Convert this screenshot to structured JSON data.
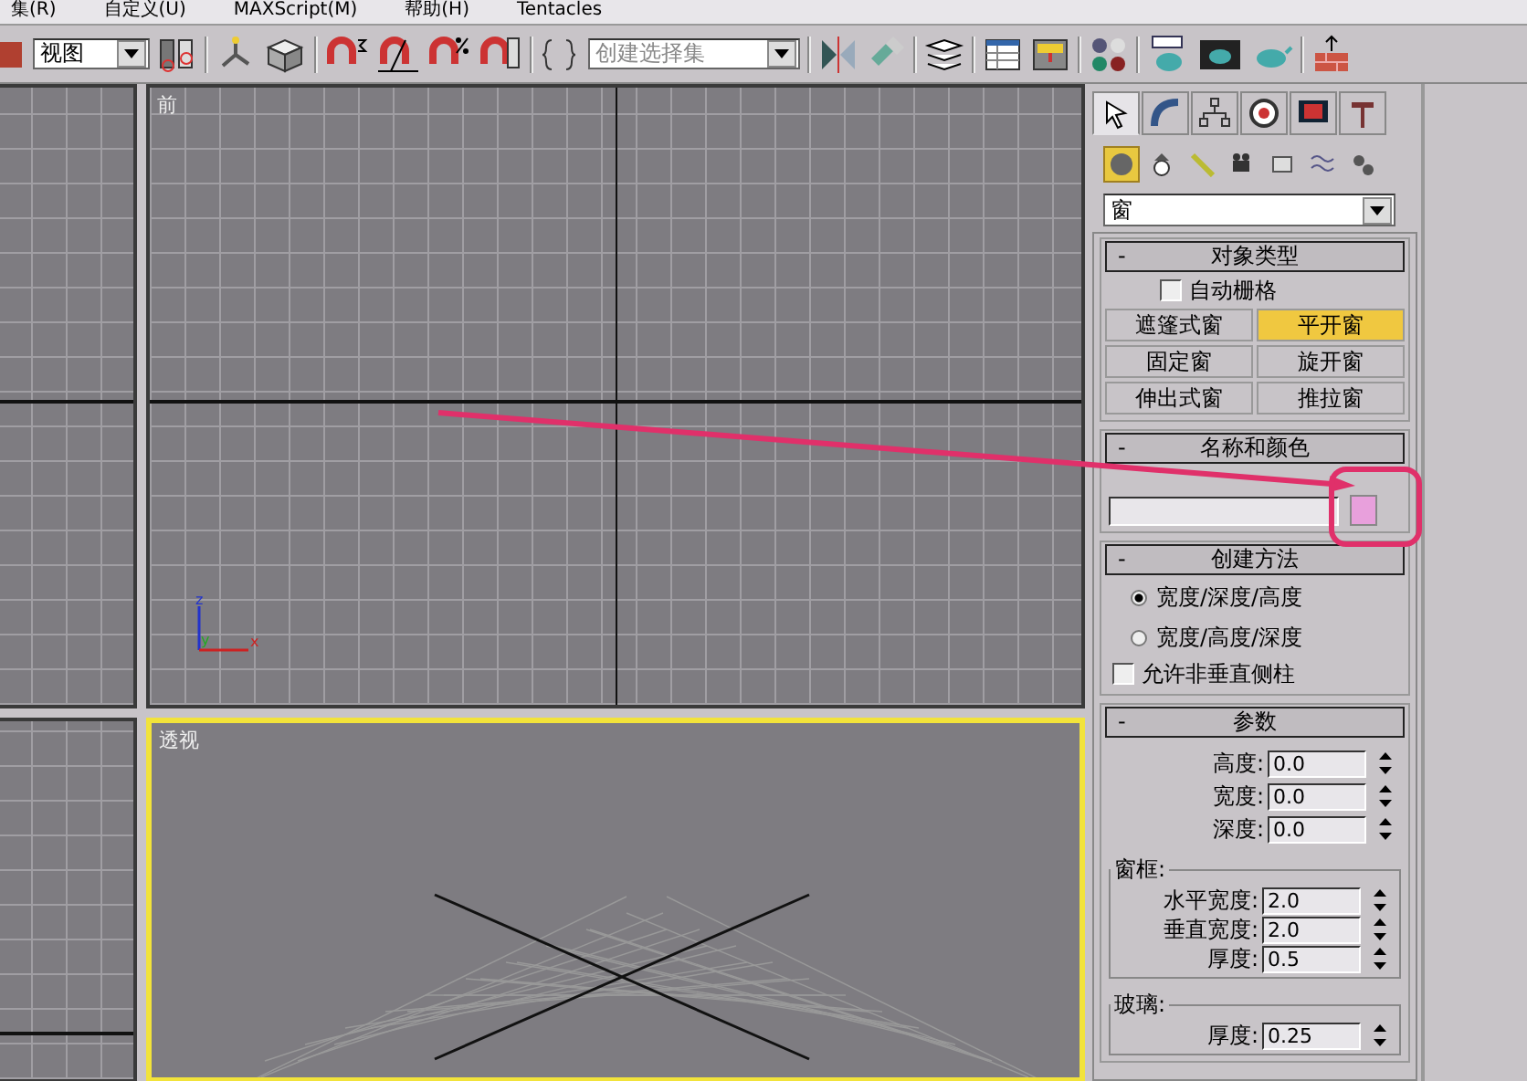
{
  "menu": [
    "集(R)",
    "自定义(U)",
    "MAXScript(M)",
    "帮助(H)",
    "Tentacles"
  ],
  "toolbar": {
    "view_dropdown": "视图",
    "selection_set_placeholder": "创建选择集"
  },
  "viewports": [
    {
      "active": false,
      "kind": "side"
    },
    {
      "label": "前",
      "active": false,
      "kind": "front",
      "axes": [
        "z",
        "y",
        "x"
      ]
    },
    {
      "active": false,
      "kind": "side"
    },
    {
      "label": "透视",
      "active": true,
      "kind": "perspective"
    }
  ],
  "command_panel": {
    "tabs": [
      {
        "kind": "create",
        "selected": true
      },
      {
        "kind": "modify",
        "selected": false
      },
      {
        "kind": "hierarchy",
        "selected": false
      },
      {
        "kind": "motion",
        "selected": false
      },
      {
        "kind": "display",
        "selected": false
      },
      {
        "kind": "utilities",
        "selected": false
      }
    ],
    "categories": [
      {
        "kind": "geometry",
        "selected": true
      },
      {
        "kind": "shapes",
        "selected": false
      },
      {
        "kind": "lights",
        "selected": false
      },
      {
        "kind": "cameras",
        "selected": false
      },
      {
        "kind": "helpers",
        "selected": false
      },
      {
        "kind": "spacewarps",
        "selected": false
      },
      {
        "kind": "systems",
        "selected": false
      }
    ],
    "category_dropdown": "窗",
    "object_type": {
      "toggle": "-",
      "title": "对象类型",
      "autogrid": {
        "label": "自动栅格",
        "checked": false
      },
      "buttons": [
        {
          "label": "遮篷式窗",
          "selected": false
        },
        {
          "label": "平开窗",
          "selected": true
        },
        {
          "label": "固定窗",
          "selected": false
        },
        {
          "label": "旋开窗",
          "selected": false
        },
        {
          "label": "伸出式窗",
          "selected": false
        },
        {
          "label": "推拉窗",
          "selected": false
        }
      ]
    },
    "name_and_color": {
      "toggle": "-",
      "title": "名称和颜色",
      "color": "#e8a0dc"
    },
    "creation_method": {
      "toggle": "-",
      "title": "创建方法",
      "options": [
        {
          "label": "宽度/深度/高度",
          "selected": true
        },
        {
          "label": "宽度/高度/深度",
          "selected": false
        }
      ],
      "allow_checkbox": {
        "label": "允许非垂直侧柱",
        "checked": false
      }
    },
    "parameters": {
      "toggle": "-",
      "title": "参数",
      "fields": [
        {
          "label": "高度:",
          "value": "0.0"
        },
        {
          "label": "宽度:",
          "value": "0.0"
        },
        {
          "label": "深度:",
          "value": "0.0"
        }
      ],
      "frame_group": {
        "title": "窗框:",
        "fields": [
          {
            "label": "水平宽度:",
            "value": "2.0"
          },
          {
            "label": "垂直宽度:",
            "value": "2.0"
          },
          {
            "label": "厚度:",
            "value": "0.5"
          }
        ]
      },
      "glass_group": {
        "title": "玻璃:",
        "fields": [
          {
            "label": "厚度:",
            "value": "0.25"
          }
        ]
      }
    }
  }
}
